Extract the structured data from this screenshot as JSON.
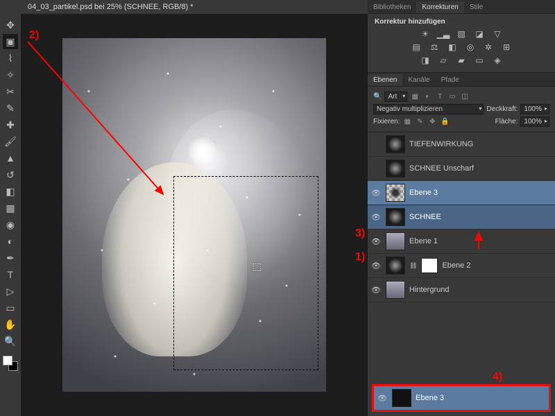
{
  "tab": {
    "title": "04_03_partikel.psd bei 25% (SCHNEE, RGB/8) *"
  },
  "panels": {
    "top_tabs": [
      "Bibliotheken",
      "Korrekturen",
      "Stile"
    ],
    "korrektur_title": "Korrektur hinzufügen",
    "layers_tabs": [
      "Ebenen",
      "Kanäle",
      "Pfade"
    ],
    "filter_label": "Art",
    "blend_mode": "Negativ multiplizieren",
    "opacity_label": "Deckkraft:",
    "opacity_value": "100%",
    "lock_label": "Fixieren:",
    "fill_label": "Fläche:",
    "fill_value": "100%"
  },
  "layers": [
    {
      "name": "TIEFENWIRKUNG",
      "visible": false,
      "thumb": "dark"
    },
    {
      "name": "SCHNEE Unscharf",
      "visible": false,
      "thumb": "dark"
    },
    {
      "name": "Ebene 3",
      "visible": true,
      "thumb": "checker",
      "selected": true
    },
    {
      "name": "SCHNEE",
      "visible": true,
      "thumb": "dark",
      "selected": true
    },
    {
      "name": "Ebene 1",
      "visible": true,
      "thumb": "photo"
    },
    {
      "name": "Ebene 2",
      "visible": true,
      "thumb": "dark",
      "mask": true
    },
    {
      "name": "Hintergrund",
      "visible": true,
      "thumb": "photo"
    }
  ],
  "bottom_layer": {
    "name": "Ebene 3"
  },
  "annotations": {
    "a1": "1)",
    "a2": "2)",
    "a3": "3)",
    "a4": "4)"
  }
}
